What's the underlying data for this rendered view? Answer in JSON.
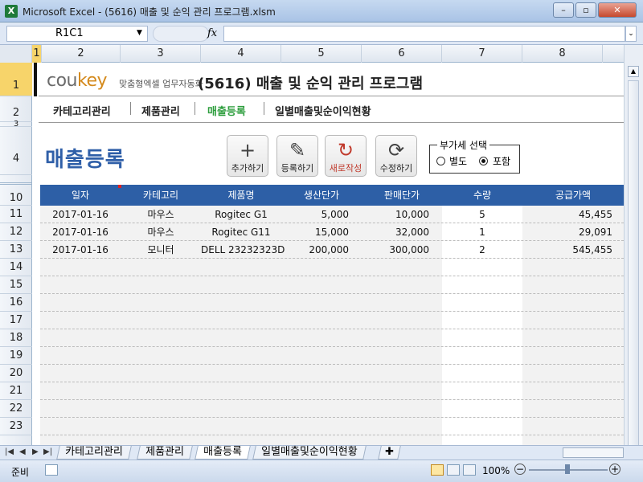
{
  "window": {
    "title": "Microsoft Excel - (5616) 매출 및 순익 관리 프로그램.xlsm",
    "app_icon": "X",
    "minimize": "–",
    "restore": "▫",
    "close": "✕"
  },
  "formula_bar": {
    "name_box": "R1C1",
    "fx": "fx",
    "value": ""
  },
  "columns": [
    "1",
    "2",
    "3",
    "4",
    "5",
    "6",
    "7",
    "8"
  ],
  "rows": [
    "1",
    "2",
    "3",
    "4",
    "10",
    "11",
    "12",
    "13",
    "14",
    "15",
    "16",
    "17",
    "18",
    "19",
    "20",
    "21",
    "22",
    "23"
  ],
  "header": {
    "logo_co": "cou",
    "logo_key": "key",
    "logo_sub": "맞춤형엑셀 업무자동화",
    "app_title": "(5616) 매출 및 순익 관리 프로그램"
  },
  "nav": [
    "카테고리관리",
    "제품관리",
    "매출등록",
    "일별매출및순이익현황"
  ],
  "nav_active_color": "#2e9e3e",
  "page_heading": "매출등록",
  "toolbar": [
    {
      "icon": "plus-icon",
      "glyph": "+",
      "label": "추가하기"
    },
    {
      "icon": "pencil-icon",
      "glyph": "✎",
      "label": "등록하기"
    },
    {
      "icon": "refresh-red-icon",
      "glyph": "↻",
      "label": "새로작성"
    },
    {
      "icon": "sync-icon",
      "glyph": "⟳",
      "label": "수정하기"
    }
  ],
  "vat": {
    "legend": "부가세 선택",
    "options": [
      "별도",
      "포함"
    ],
    "selected": "포함"
  },
  "table": {
    "headers": [
      "일자",
      "카테고리",
      "제품명",
      "생산단가",
      "판매단가",
      "수량",
      "공급가액"
    ],
    "rows": [
      [
        "2017-01-16",
        "마우스",
        "Rogitec G1",
        "5,000",
        "10,000",
        "5",
        "45,455"
      ],
      [
        "2017-01-16",
        "마우스",
        "Rogitec G11",
        "15,000",
        "32,000",
        "1",
        "29,091"
      ],
      [
        "2017-01-16",
        "모니터",
        "DELL 23232323D",
        "200,000",
        "300,000",
        "2",
        "545,455"
      ]
    ]
  },
  "sheet_tabs": [
    "카테고리관리",
    "제품관리",
    "매출등록",
    "일별매출및순이익현황"
  ],
  "active_tab": "매출등록",
  "status": {
    "ready": "준비",
    "zoom": "100%"
  }
}
